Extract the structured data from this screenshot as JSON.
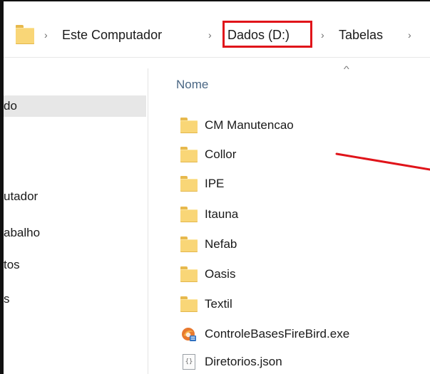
{
  "breadcrumb": {
    "items": [
      "Este Computador",
      "Dados (D:)",
      "Tabelas"
    ],
    "separator": "›",
    "highlighted_index": 1,
    "highlight_color": "#e0141a"
  },
  "nav_pane": {
    "items": [
      {
        "label": "do",
        "selected": true
      },
      {
        "label": "utador",
        "selected": false
      },
      {
        "label": "abalho",
        "selected": false
      },
      {
        "label": "tos",
        "selected": false
      },
      {
        "label": "s",
        "selected": false
      }
    ]
  },
  "file_list": {
    "column_header": "Nome",
    "sort_indicator": "^",
    "items": [
      {
        "name": "CM Manutencao",
        "icon": "folder-icon"
      },
      {
        "name": "Collor",
        "icon": "folder-icon"
      },
      {
        "name": "IPE",
        "icon": "folder-icon"
      },
      {
        "name": "Itauna",
        "icon": "folder-icon"
      },
      {
        "name": "Nefab",
        "icon": "folder-icon"
      },
      {
        "name": "Oasis",
        "icon": "folder-icon"
      },
      {
        "name": "Textil",
        "icon": "folder-icon"
      },
      {
        "name": "ControleBasesFireBird.exe",
        "icon": "exe-icon"
      },
      {
        "name": "Diretorios.json",
        "icon": "json-file-icon"
      }
    ]
  },
  "json_icon_glyph": "{}",
  "colors": {
    "folder": "#f9d677",
    "annotation": "#e0141a",
    "header_text": "#4a6784"
  }
}
